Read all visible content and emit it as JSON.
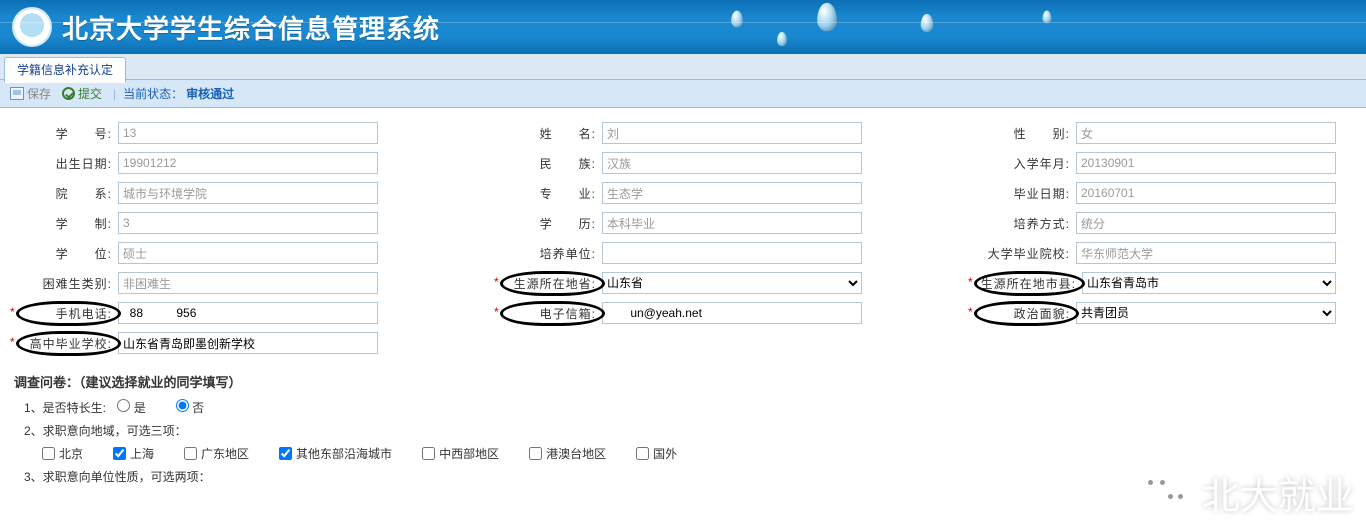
{
  "header": {
    "title": "北京大学学生综合信息管理系统"
  },
  "tab": {
    "main": "学籍信息补充认定"
  },
  "toolbar": {
    "save": "保存",
    "submit": "提交",
    "status_label": "当前状态：",
    "status_value": "审核通过"
  },
  "form": {
    "student_id": {
      "label": "学　　号:",
      "value": "13"
    },
    "name": {
      "label": "姓　　名:",
      "value": "刘"
    },
    "gender": {
      "label": "性　　别:",
      "value": "女"
    },
    "birth": {
      "label": "出生日期:",
      "value": "19901212"
    },
    "ethnic": {
      "label": "民　　族:",
      "value": "汉族"
    },
    "enroll": {
      "label": "入学年月:",
      "value": "20130901"
    },
    "college": {
      "label": "院　　系:",
      "value": "城市与环境学院"
    },
    "major": {
      "label": "专　　业:",
      "value": "生态学"
    },
    "grad_date": {
      "label": "毕业日期:",
      "value": "20160701"
    },
    "system": {
      "label": "学　　制:",
      "value": "3"
    },
    "edu": {
      "label": "学　　历:",
      "value": "本科毕业"
    },
    "train": {
      "label": "培养方式:",
      "value": "统分"
    },
    "degree": {
      "label": "学　　位:",
      "value": "硕士"
    },
    "train_unit": {
      "label": "培养单位:",
      "value": ""
    },
    "ug_school": {
      "label": "大学毕业院校:",
      "value": "华东师范大学"
    },
    "hardship": {
      "label": "困难生类别:",
      "value": "非困难生"
    },
    "origin_prov": {
      "label": "生源所在地省:",
      "value": "山东省"
    },
    "origin_city": {
      "label": "生源所在地市县:",
      "value": "山东省青岛市"
    },
    "phone": {
      "label": "手机电话:",
      "value": "  88          956"
    },
    "email": {
      "label": "电子信箱:",
      "value": "       un@yeah.net"
    },
    "politics": {
      "label": "政治面貌:",
      "value": "共青团员"
    },
    "highschool": {
      "label": "高中毕业学校:",
      "value": "山东省青岛即墨创新学校"
    }
  },
  "survey": {
    "title": "调查问卷：（建议选择就业的同学填写）",
    "q1": {
      "text": "1、是否特长生:",
      "yes": "是",
      "no": "否",
      "value": "no"
    },
    "q2": {
      "text": "2、求职意向地域，可选三项：",
      "opts": [
        "北京",
        "上海",
        "广东地区",
        "其他东部沿海城市",
        "中西部地区",
        "港澳台地区",
        "国外"
      ],
      "checked": [
        1,
        3
      ]
    },
    "q3": {
      "text": "3、求职意向单位性质，可选两项："
    }
  },
  "watermark": "北大就业"
}
